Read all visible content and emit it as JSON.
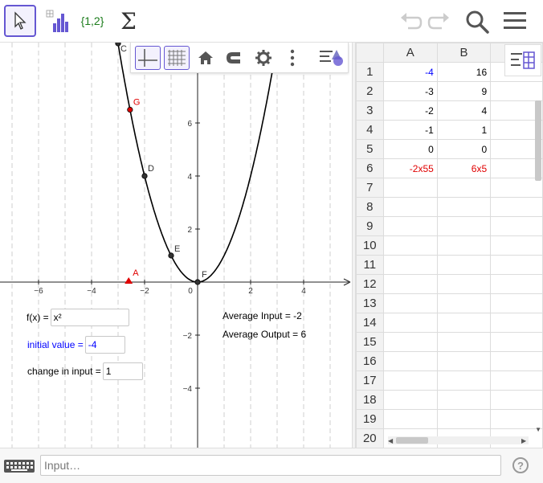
{
  "toolbar": {
    "set_label": "{1,2}",
    "sigma_label": "Σ"
  },
  "graph": {
    "x_ticks": [
      "−6",
      "−4",
      "−2",
      "0",
      "2",
      "4"
    ],
    "y_ticks": [
      "6",
      "4",
      "2",
      "−2",
      "−4"
    ],
    "points": [
      {
        "label": "A",
        "x": -2.6,
        "y": 0,
        "color": "#e00000"
      },
      {
        "label": "C",
        "x": -3,
        "y": 9,
        "color": "#333333"
      },
      {
        "label": "D",
        "x": -2,
        "y": 4,
        "color": "#333333"
      },
      {
        "label": "E",
        "x": -1,
        "y": 1,
        "color": "#333333"
      },
      {
        "label": "F",
        "x": 0,
        "y": 0,
        "color": "#333333"
      },
      {
        "label": "G",
        "x": -2.55,
        "y": 6.5,
        "color": "#e00000"
      }
    ],
    "function_label": "f(x) =",
    "function_value": "x²",
    "initial_value_label": "initial value =",
    "initial_value": "-4",
    "change_label": "change in input =",
    "change_value": "1",
    "avg_input": "Average Input = -2",
    "avg_output": "Average Output = 6"
  },
  "spreadsheet": {
    "columns": [
      "A",
      "B"
    ],
    "rows": [
      {
        "num": "1",
        "a": "-4",
        "b": "16",
        "a_class": "blue",
        "b_class": ""
      },
      {
        "num": "2",
        "a": "-3",
        "b": "9",
        "a_class": "",
        "b_class": ""
      },
      {
        "num": "3",
        "a": "-2",
        "b": "4",
        "a_class": "",
        "b_class": ""
      },
      {
        "num": "4",
        "a": "-1",
        "b": "1",
        "a_class": "",
        "b_class": ""
      },
      {
        "num": "5",
        "a": "0",
        "b": "0",
        "a_class": "",
        "b_class": ""
      },
      {
        "num": "6",
        "a": "-2x55",
        "b": "6x5",
        "a_class": "red",
        "b_class": "red"
      },
      {
        "num": "7",
        "a": "",
        "b": ""
      },
      {
        "num": "8",
        "a": "",
        "b": ""
      },
      {
        "num": "9",
        "a": "",
        "b": ""
      },
      {
        "num": "10",
        "a": "",
        "b": ""
      },
      {
        "num": "11",
        "a": "",
        "b": ""
      },
      {
        "num": "12",
        "a": "",
        "b": ""
      },
      {
        "num": "13",
        "a": "",
        "b": ""
      },
      {
        "num": "14",
        "a": "",
        "b": ""
      },
      {
        "num": "15",
        "a": "",
        "b": ""
      },
      {
        "num": "16",
        "a": "",
        "b": ""
      },
      {
        "num": "17",
        "a": "",
        "b": ""
      },
      {
        "num": "18",
        "a": "",
        "b": ""
      },
      {
        "num": "19",
        "a": "",
        "b": ""
      },
      {
        "num": "20",
        "a": "",
        "b": ""
      }
    ]
  },
  "input_bar": {
    "placeholder": "Input…",
    "help": "?"
  },
  "colors": {
    "accent": "#6557d2",
    "curve": "#000000",
    "red_point": "#e00000"
  }
}
